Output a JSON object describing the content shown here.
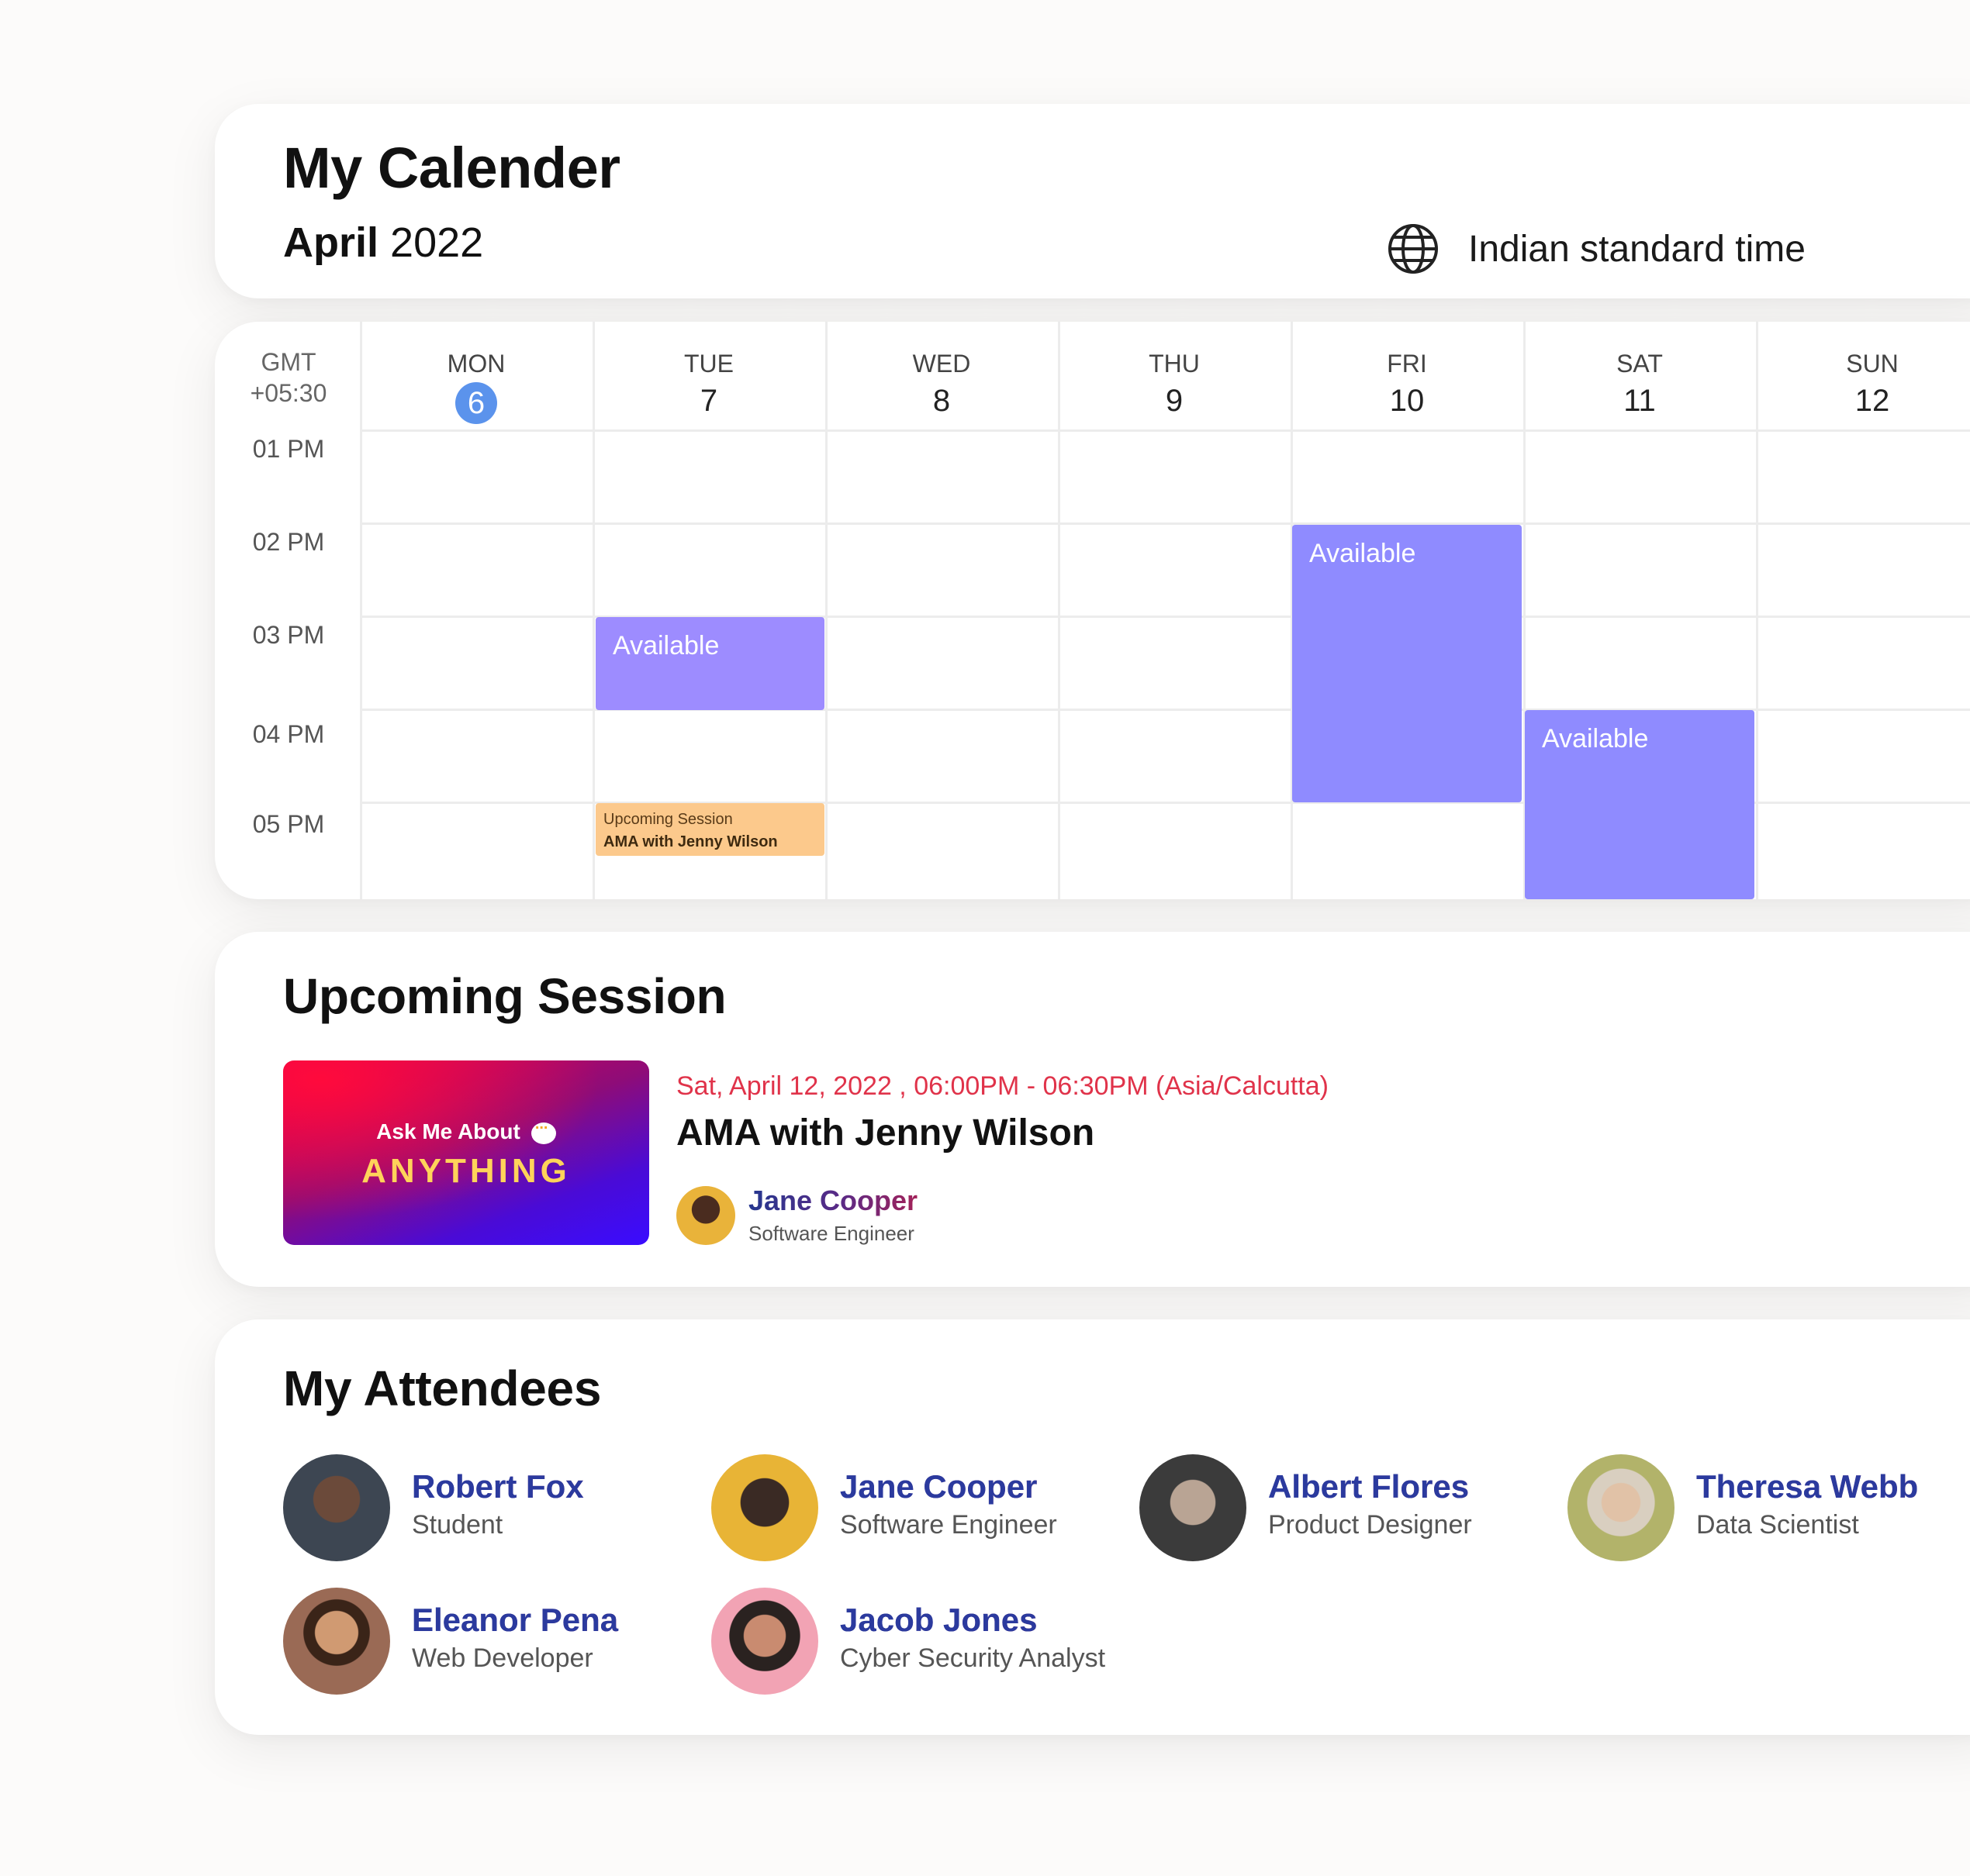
{
  "header": {
    "title": "My Calender",
    "month": "April",
    "year": "2022",
    "timezone": "Indian standard time",
    "timezone_icon": "globe-icon"
  },
  "calendar": {
    "gmt_line1": "GMT",
    "gmt_line2": "+05:30",
    "days": [
      {
        "name": "MON",
        "num": "6",
        "today": true
      },
      {
        "name": "TUE",
        "num": "7"
      },
      {
        "name": "WED",
        "num": "8"
      },
      {
        "name": "THU",
        "num": "9"
      },
      {
        "name": "FRI",
        "num": "10"
      },
      {
        "name": "SAT",
        "num": "11"
      },
      {
        "name": "SUN",
        "num": "12"
      }
    ],
    "times": [
      "01 PM",
      "02 PM",
      "03 PM",
      "04 PM",
      "05 PM"
    ],
    "available_label": "Available",
    "available_color": "#8f8bff",
    "available_color_tue": "#9d8cff",
    "event": {
      "label": "Upcoming Session",
      "title": "AMA with Jenny Wilson",
      "color": "#fcc98c"
    }
  },
  "upcoming": {
    "section_title": "Upcoming Session",
    "thumb_line1": "Ask Me About",
    "thumb_line2": "ANYTHING",
    "date": "Sat, April 12, 2022 , 06:00PM - 06:30PM (Asia/Calcutta)",
    "title": "AMA with Jenny Wilson",
    "host_name": "Jane Cooper",
    "host_role": "Software Engineer"
  },
  "attendees": {
    "section_title": "My Attendees",
    "list": [
      {
        "name": "Robert Fox",
        "role": "Student"
      },
      {
        "name": "Jane Cooper",
        "role": "Software Engineer"
      },
      {
        "name": "Albert Flores",
        "role": "Product Designer"
      },
      {
        "name": "Theresa Webb",
        "role": "Data Scientist"
      },
      {
        "name": "Eleanor Pena",
        "role": "Web Developer"
      },
      {
        "name": "Jacob Jones",
        "role": "Cyber Security Analyst"
      }
    ]
  }
}
